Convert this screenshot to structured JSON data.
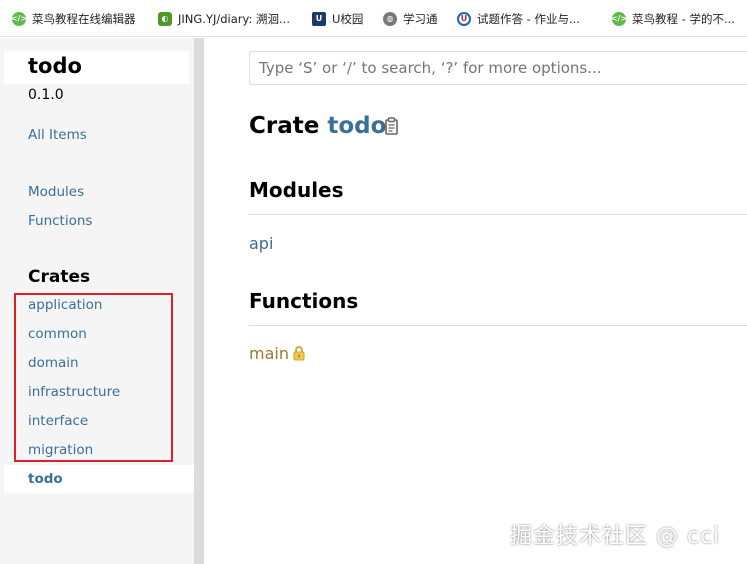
{
  "bookmarks": [
    {
      "label": "菜鸟教程在线编辑器",
      "icon": "runoob-icon"
    },
    {
      "label": "JING.YJ/diary: 溯洄...",
      "icon": "gitee-icon"
    },
    {
      "label": "U校园",
      "icon": "u-campus-icon"
    },
    {
      "label": "学习通",
      "icon": "globe-icon"
    },
    {
      "label": "试题作答 - 作业与...",
      "icon": "u-exam-icon"
    },
    {
      "label": "菜鸟教程 - 学的不...",
      "icon": "runoob-icon"
    }
  ],
  "sidebar": {
    "crate_name": "todo",
    "version": "0.1.0",
    "all_items": "All Items",
    "sections": [
      "Modules",
      "Functions"
    ],
    "crates_heading": "Crates",
    "crates": [
      "application",
      "common",
      "domain",
      "infrastructure",
      "interface",
      "migration"
    ],
    "current_crate": "todo"
  },
  "search": {
    "placeholder": "Type ‘S’ or ‘/’ to search, ‘?’ for more options..."
  },
  "main": {
    "title_keyword": "Crate",
    "title_name": "todo",
    "modules_heading": "Modules",
    "modules": [
      "api"
    ],
    "functions_heading": "Functions",
    "functions": [
      "main"
    ]
  },
  "watermark": "掘金技术社区 @ cci",
  "colors": {
    "link": "#3a6f96",
    "function": "#9a7a2e",
    "highlight_box": "#d9222a",
    "sidebar_bg": "#f5f5f5"
  }
}
